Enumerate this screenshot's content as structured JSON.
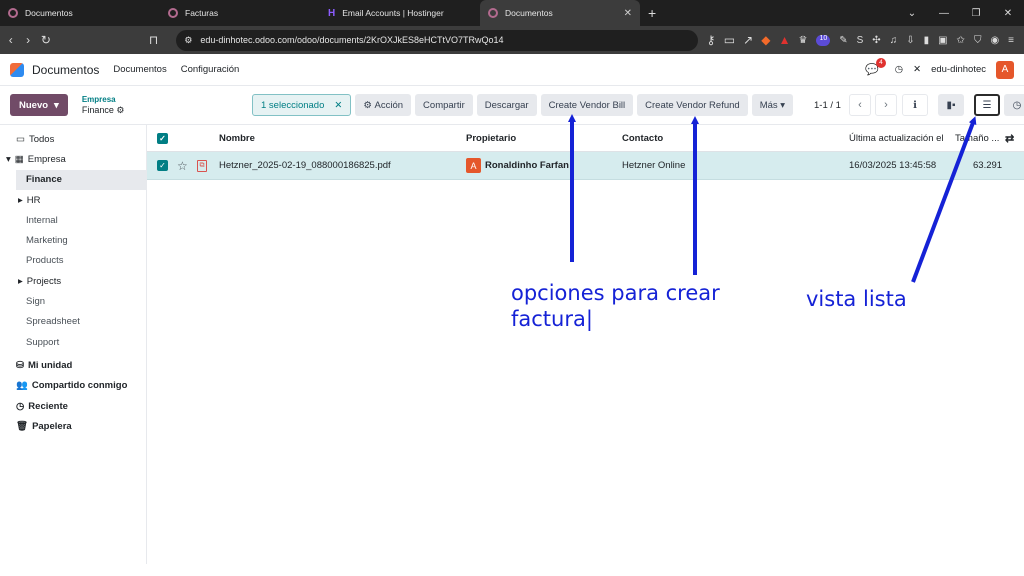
{
  "browser": {
    "tabs": [
      {
        "label": "Documentos",
        "icon": "odoo-tab-icon",
        "active": false
      },
      {
        "label": "Facturas",
        "icon": "odoo-tab-icon",
        "active": false
      },
      {
        "label": "Email Accounts | Hostinger",
        "icon": "hostinger-tab-icon",
        "active": false
      },
      {
        "label": "Documentos",
        "icon": "odoo-tab-icon",
        "active": true
      }
    ],
    "url": "edu-dinhotec.odoo.com/odoo/documents/2KrOXJkES8eHCTtVO7TRwQo14",
    "extension_badge": "10"
  },
  "navbar": {
    "app_name": "Documentos",
    "menu": [
      "Documentos",
      "Configuración"
    ],
    "chat_count": "4",
    "company": "edu-dinhotec",
    "avatar_letter": "A"
  },
  "control": {
    "new_label": "Nuevo",
    "breadcrumb_parent": "Empresa",
    "breadcrumb_current": "Finance",
    "selected_label": "1 seleccionado",
    "action_label": "Acción",
    "share_label": "Compartir",
    "download_label": "Descargar",
    "vendor_bill_label": "Create Vendor Bill",
    "vendor_refund_label": "Create Vendor Refund",
    "more_label": "Más",
    "pager": "1-1 / 1"
  },
  "sidebar": {
    "all": "Todos",
    "company": "Empresa",
    "items": [
      "Finance",
      "HR",
      "Internal",
      "Marketing",
      "Products",
      "Projects",
      "Sign",
      "Spreadsheet",
      "Support"
    ],
    "my_drive": "Mi unidad",
    "shared": "Compartido conmigo",
    "recent": "Reciente",
    "trash": "Papelera"
  },
  "table": {
    "headers": {
      "name": "Nombre",
      "owner": "Propietario",
      "contact": "Contacto",
      "updated": "Última actualización el",
      "size": "Tamaño ..."
    },
    "rows": [
      {
        "name": "Hetzner_2025-02-19_088000186825.pdf",
        "owner_initial": "A",
        "owner": "Ronaldinho Farfan",
        "contact": "Hetzner Online",
        "updated": "16/03/2025 13:45:58",
        "size": "63.291"
      }
    ]
  },
  "annotations": {
    "create_invoice_note_line1": "opciones para crear",
    "create_invoice_note_line2": "factura|",
    "list_view_note": "vista lista",
    "color": "#1522d6"
  }
}
